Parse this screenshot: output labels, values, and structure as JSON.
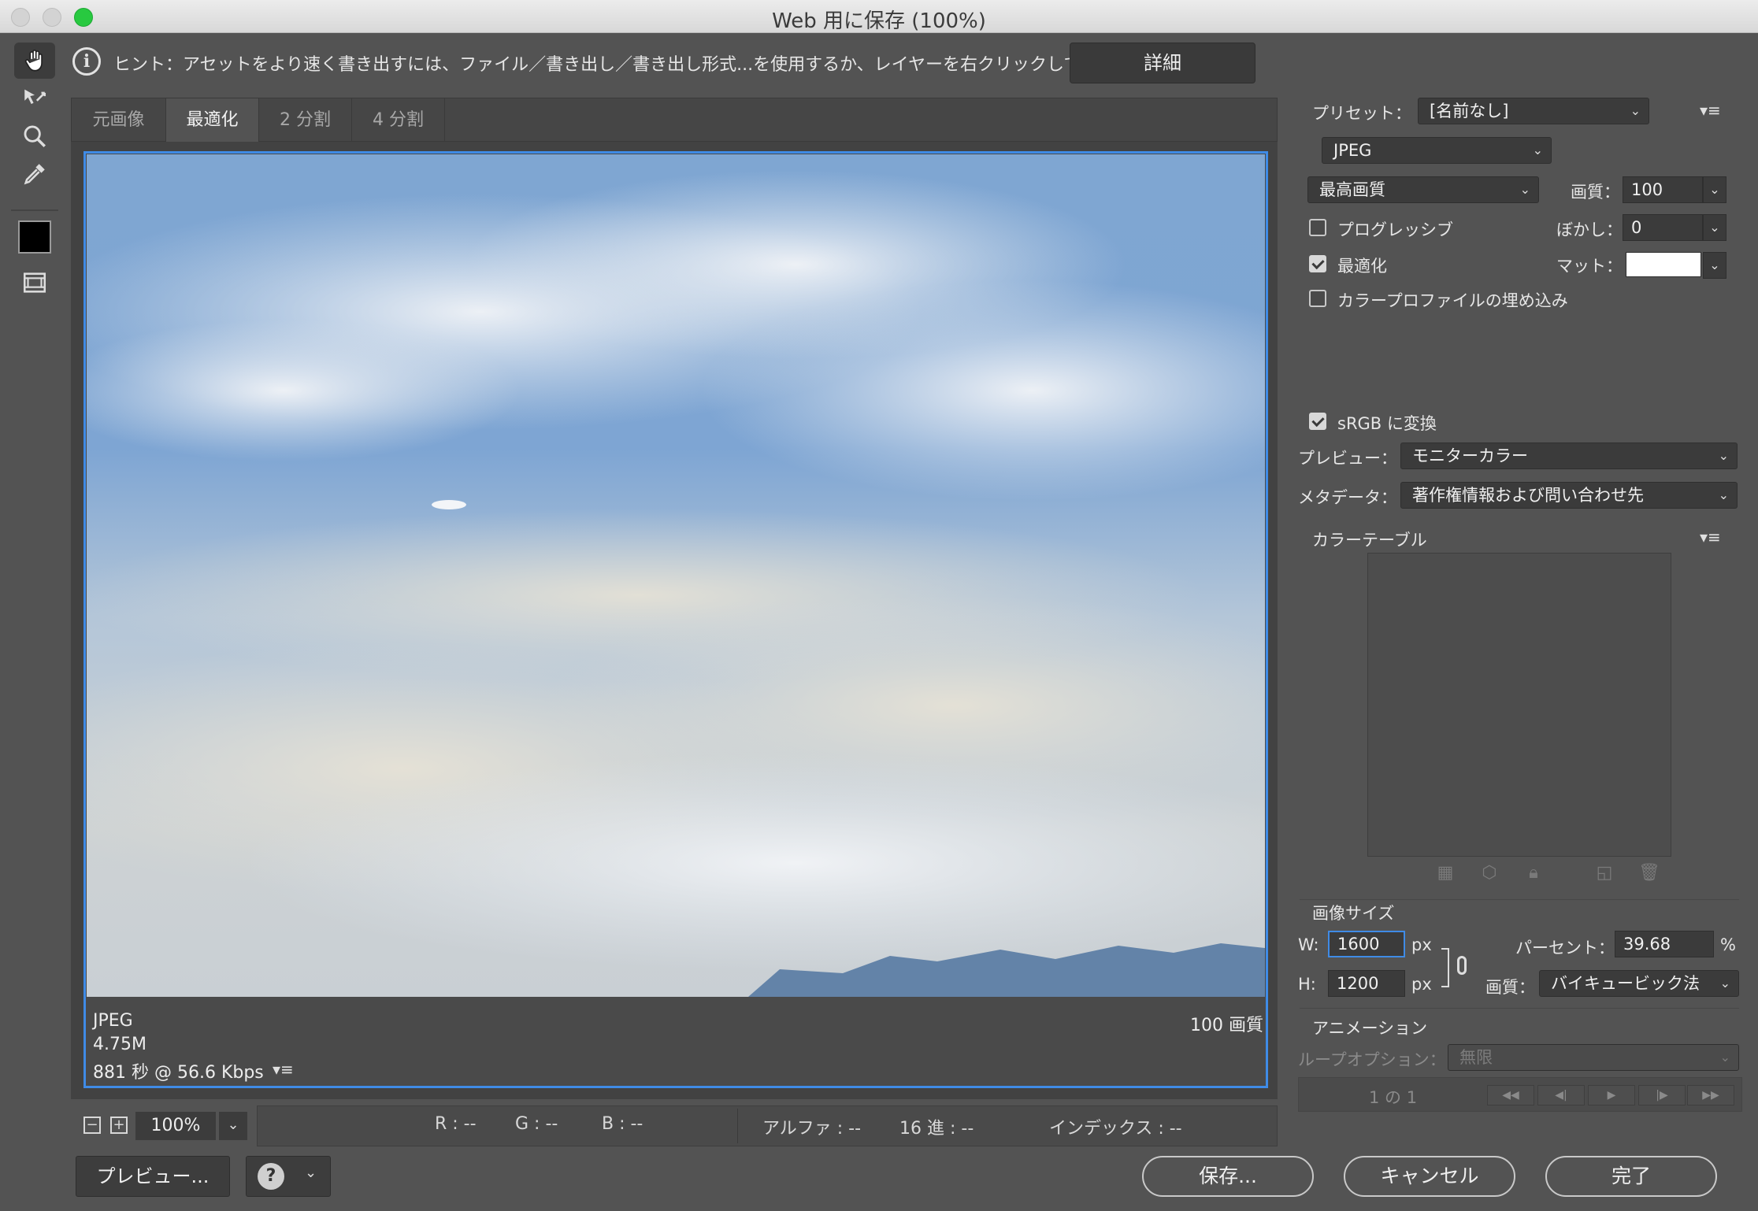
{
  "window": {
    "title": "Web 用に保存 (100%)"
  },
  "hint": {
    "icon": "info-icon",
    "text": "ヒント：アセットをより速く書き出すには、ファイル／書き出し／書き出し形式...を使用するか、レイヤーを右クリックして使用。",
    "detail_button": "詳細"
  },
  "tabs": [
    {
      "label": "元画像"
    },
    {
      "label": "最適化"
    },
    {
      "label": "2 分割"
    },
    {
      "label": "4 分割"
    }
  ],
  "tools": [
    "hand-icon",
    "slice-select-icon",
    "zoom-icon",
    "eyedropper-icon",
    "eyedropper-color-swatch",
    "toggle-slices-icon"
  ],
  "preview_info": {
    "format": "JPEG",
    "size": "4.75M",
    "download_time": "881 秒 @ 56.6 Kbps",
    "quality_text": "100 画質"
  },
  "status": {
    "zoom": "100%",
    "r": "R : --",
    "g": "G : --",
    "b": "B : --",
    "alpha": "アルファ : --",
    "hex": "16 進 : --",
    "index": "インデックス : --"
  },
  "buttons": {
    "preview": "プレビュー...",
    "save": "保存...",
    "cancel": "キャンセル",
    "done": "完了"
  },
  "settings": {
    "preset_label": "プリセット：",
    "preset_value": "[名前なし]",
    "format_value": "JPEG",
    "quality_preset": "最高画質",
    "quality_label": "画質：",
    "quality_value": "100",
    "progressive_label": "プログレッシブ",
    "progressive_checked": false,
    "blur_label": "ぼかし：",
    "blur_value": "0",
    "optimized_label": "最適化",
    "optimized_checked": true,
    "matte_label": "マット：",
    "matte_color": "#ffffff",
    "embed_profile_label": "カラープロファイルの埋め込み",
    "embed_profile_checked": false,
    "srgb_label": "sRGB に変換",
    "srgb_checked": true,
    "preview_label": "プレビュー：",
    "preview_value": "モニターカラー",
    "metadata_label": "メタデータ：",
    "metadata_value": "著作権情報および問い合わせ先"
  },
  "color_table": {
    "title": "カラーテーブル"
  },
  "image_size": {
    "title": "画像サイズ",
    "w_label": "W:",
    "w_value": "1600",
    "h_label": "H:",
    "h_value": "1200",
    "unit": "px",
    "percent_label": "パーセント：",
    "percent_value": "39.68",
    "percent_unit": "%",
    "quality_label": "画質：",
    "quality_value": "バイキュービック法"
  },
  "animation": {
    "title": "アニメーション",
    "loop_label": "ループオプション：",
    "loop_value": "無限",
    "frame_counter": "1 の 1"
  },
  "colors": {
    "accent": "#3f8be6",
    "panel": "#535353",
    "traffic_green": "#28c940"
  }
}
